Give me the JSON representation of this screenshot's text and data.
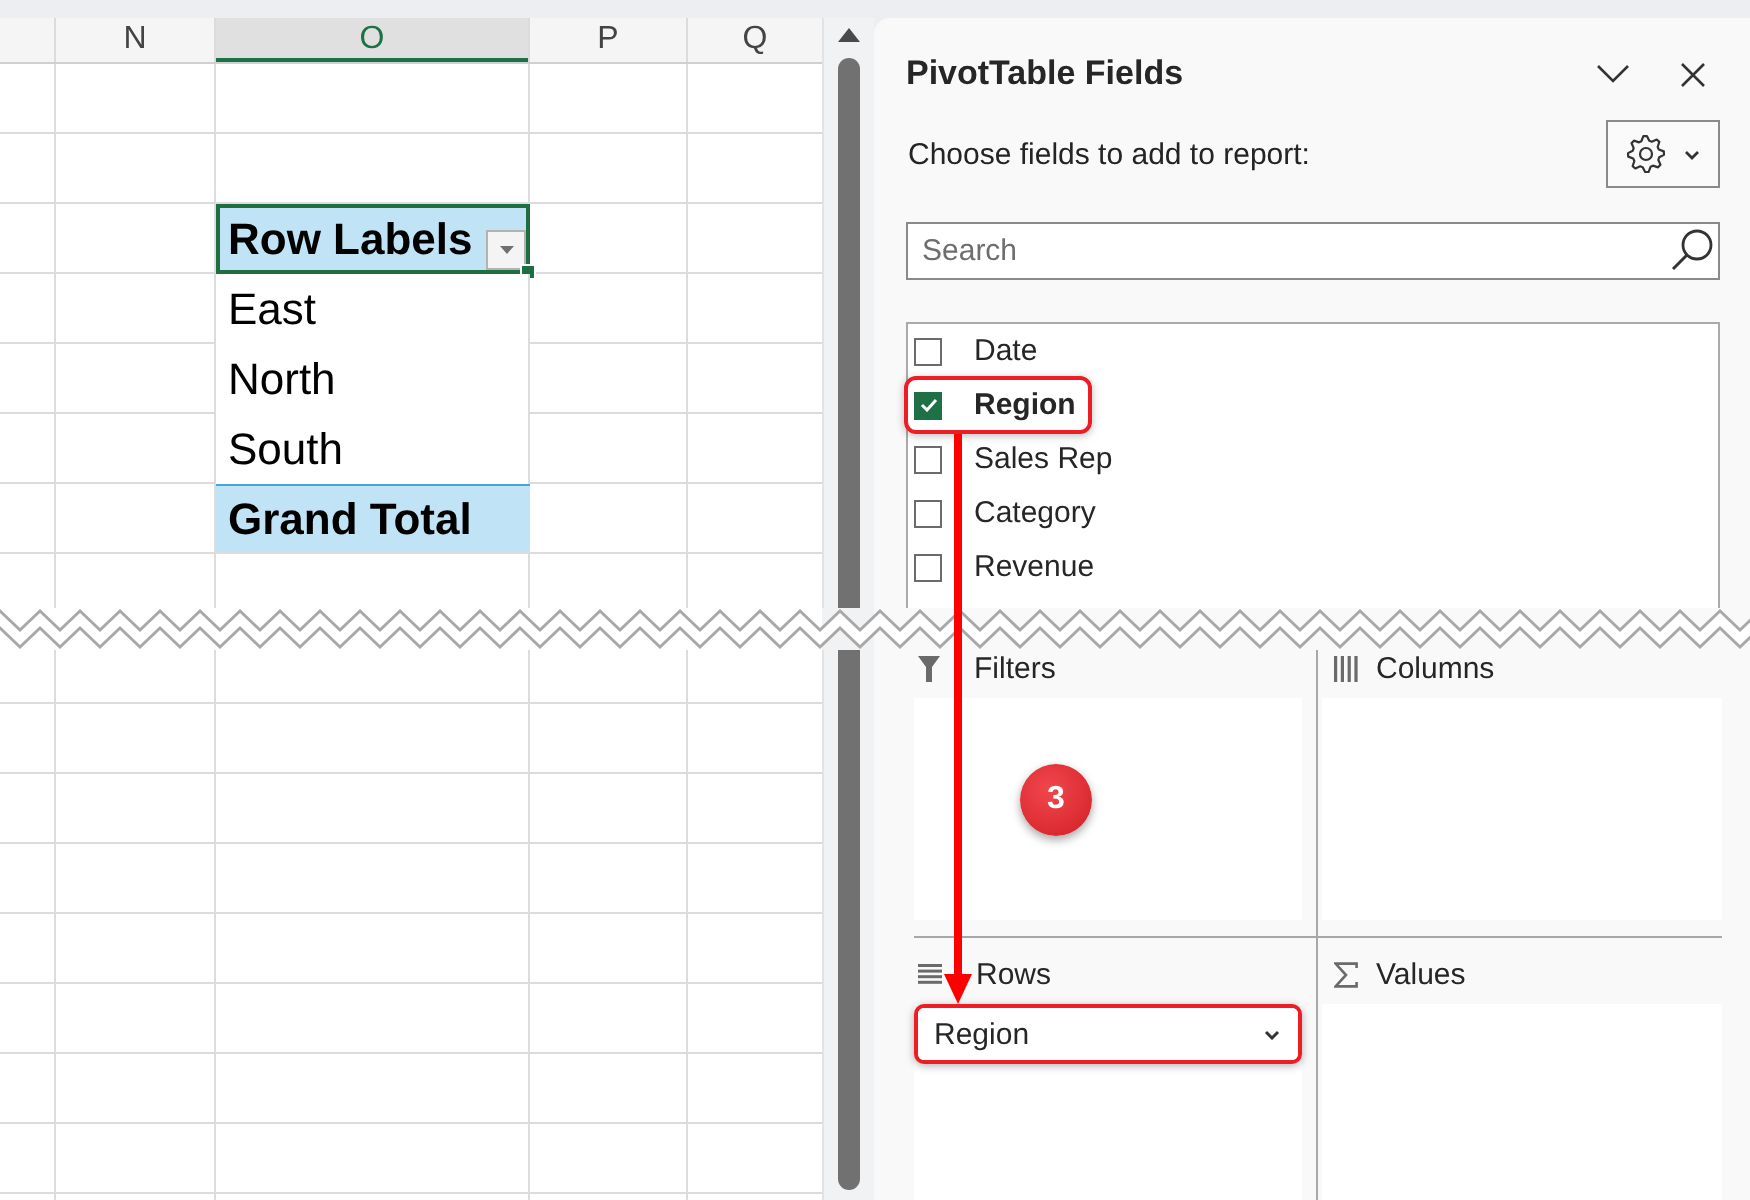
{
  "sheet": {
    "columns": [
      {
        "label": "N",
        "selected": false
      },
      {
        "label": "O",
        "selected": true
      },
      {
        "label": "P",
        "selected": false
      },
      {
        "label": "Q",
        "selected": false
      }
    ],
    "pivot_cells": [
      {
        "text": "Row Labels",
        "kind": "header",
        "selected": true
      },
      {
        "text": "East",
        "kind": "item",
        "selected": false
      },
      {
        "text": "North",
        "kind": "item",
        "selected": false
      },
      {
        "text": "South",
        "kind": "item",
        "selected": false
      },
      {
        "text": "Grand Total",
        "kind": "total",
        "selected": false
      }
    ]
  },
  "pane": {
    "title": "PivotTable Fields",
    "subtitle": "Choose fields to add to report:",
    "search": {
      "placeholder": "Search"
    },
    "fields": [
      {
        "label": "Date",
        "checked": false,
        "highlighted": false
      },
      {
        "label": "Region",
        "checked": true,
        "highlighted": true
      },
      {
        "label": "Sales Rep",
        "checked": false,
        "highlighted": false
      },
      {
        "label": "Category",
        "checked": false,
        "highlighted": false
      },
      {
        "label": "Revenue",
        "checked": false,
        "highlighted": false
      }
    ],
    "areas": [
      {
        "label": "Filters",
        "kind": "filters"
      },
      {
        "label": "Columns",
        "kind": "columns"
      },
      {
        "label": "Rows",
        "kind": "rows",
        "items": [
          {
            "label": "Region",
            "highlighted": true
          }
        ]
      },
      {
        "label": "Values",
        "kind": "values"
      }
    ]
  },
  "annotation": {
    "step": "3",
    "arrow": true
  }
}
